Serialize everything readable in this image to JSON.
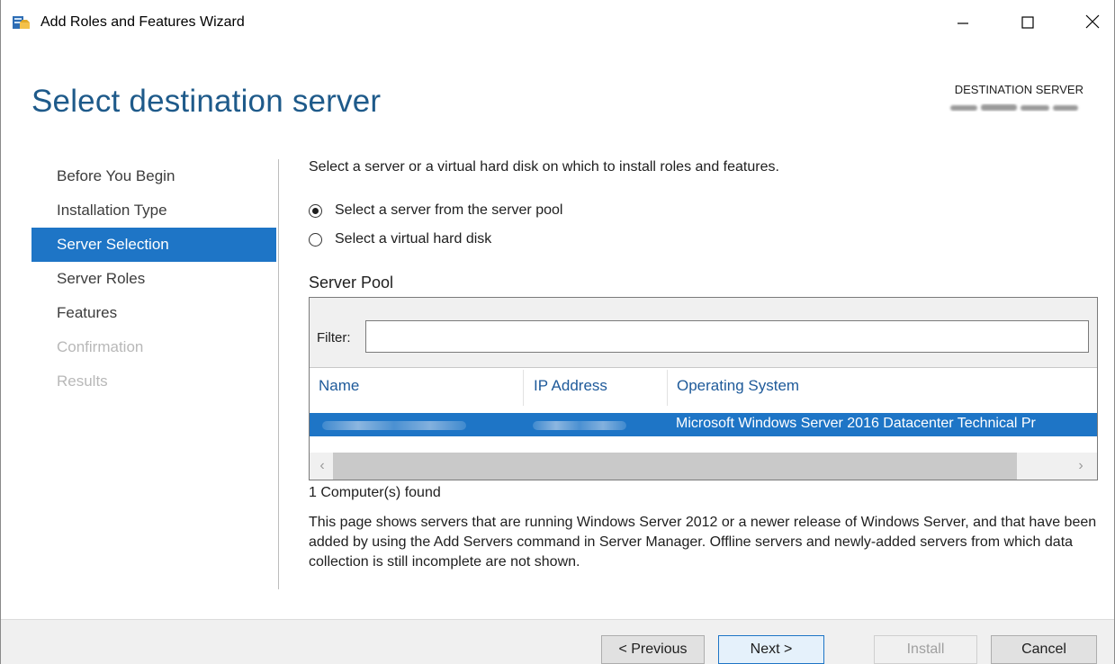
{
  "window": {
    "title": "Add Roles and Features Wizard",
    "minimize_icon": "minimize-icon",
    "maximize_icon": "maximize-icon",
    "close_icon": "close-icon"
  },
  "header": {
    "page_title": "Select destination server",
    "destination_label": "DESTINATION SERVER"
  },
  "nav": {
    "items": [
      {
        "label": "Before You Begin",
        "state": "normal"
      },
      {
        "label": "Installation Type",
        "state": "normal"
      },
      {
        "label": "Server Selection",
        "state": "active"
      },
      {
        "label": "Server Roles",
        "state": "normal"
      },
      {
        "label": "Features",
        "state": "normal"
      },
      {
        "label": "Confirmation",
        "state": "disabled"
      },
      {
        "label": "Results",
        "state": "disabled"
      }
    ]
  },
  "main": {
    "intro": "Select a server or a virtual hard disk on which to install roles and features.",
    "radio_pool": "Select a server from the server pool",
    "radio_vhd": "Select a virtual hard disk",
    "radio_selected": "pool",
    "pool_label": "Server Pool",
    "filter_label": "Filter:",
    "filter_value": "",
    "columns": [
      "Name",
      "IP Address",
      "Operating System"
    ],
    "rows": [
      {
        "os": "Microsoft Windows Server 2016 Datacenter Technical Pr"
      }
    ],
    "found": "1 Computer(s) found",
    "description": "This page shows servers that are running Windows Server 2012 or a newer release of Windows Server, and that have been added by using the Add Servers command in Server Manager. Offline servers and newly-added servers from which data collection is still incomplete are not shown."
  },
  "footer": {
    "previous": "< Previous",
    "next": "Next >",
    "install": "Install",
    "cancel": "Cancel"
  },
  "colors": {
    "accent": "#1e75c6",
    "title_blue": "#1e5a8a"
  }
}
